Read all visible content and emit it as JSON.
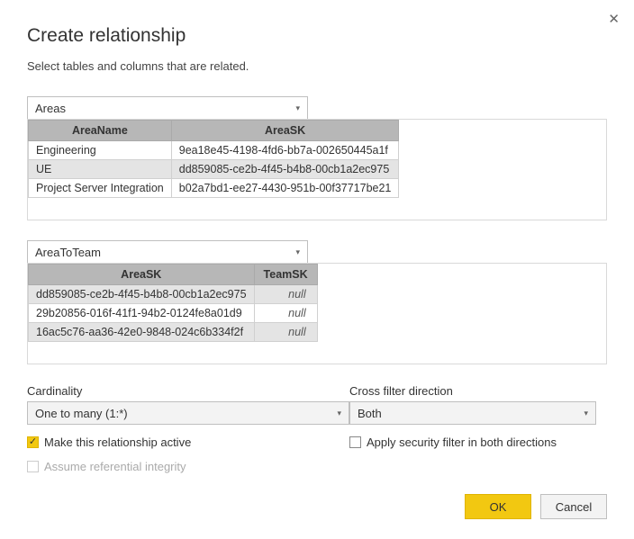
{
  "title": "Create relationship",
  "subtitle": "Select tables and columns that are related.",
  "table1": {
    "selected": "Areas",
    "headers": [
      "AreaName",
      "AreaSK"
    ],
    "rows": [
      [
        "Engineering",
        "9ea18e45-4198-4fd6-bb7a-002650445a1f"
      ],
      [
        "UE",
        "dd859085-ce2b-4f45-b4b8-00cb1a2ec975"
      ],
      [
        "Project Server Integration",
        "b02a7bd1-ee27-4430-951b-00f37717be21"
      ]
    ]
  },
  "table2": {
    "selected": "AreaToTeam",
    "headers": [
      "AreaSK",
      "TeamSK"
    ],
    "rows": [
      [
        "dd859085-ce2b-4f45-b4b8-00cb1a2ec975",
        "null"
      ],
      [
        "29b20856-016f-41f1-94b2-0124fe8a01d9",
        "null"
      ],
      [
        "16ac5c76-aa36-42e0-9848-024c6b334f2f",
        "null"
      ]
    ]
  },
  "cardinality": {
    "label": "Cardinality",
    "value": "One to many (1:*)"
  },
  "crossfilter": {
    "label": "Cross filter direction",
    "value": "Both"
  },
  "checks": {
    "active": "Make this relationship active",
    "security": "Apply security filter in both directions",
    "integrity": "Assume referential integrity"
  },
  "buttons": {
    "ok": "OK",
    "cancel": "Cancel"
  }
}
